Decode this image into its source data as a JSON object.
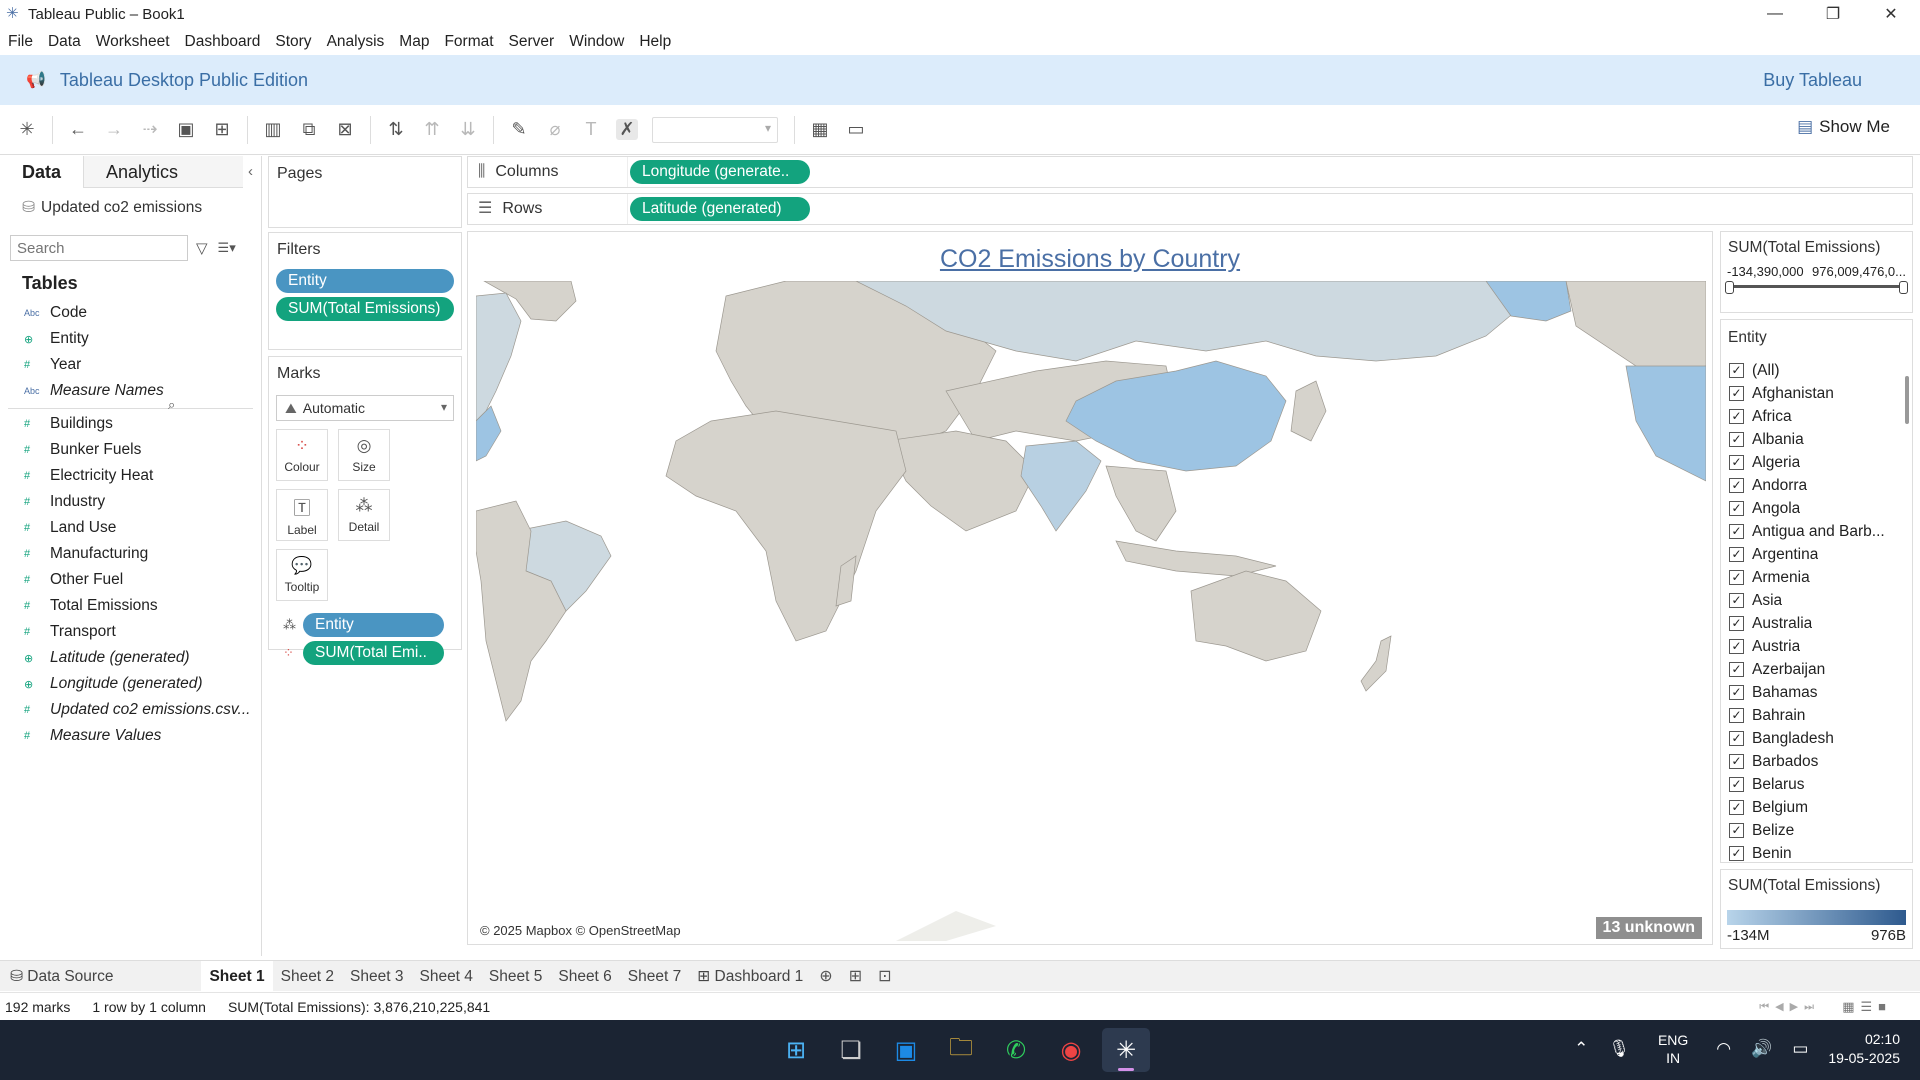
{
  "window": {
    "title": "Tableau Public – Book1"
  },
  "menu": [
    "File",
    "Data",
    "Worksheet",
    "Dashboard",
    "Story",
    "Analysis",
    "Map",
    "Format",
    "Server",
    "Window",
    "Help"
  ],
  "banner": {
    "edition": "Tableau Desktop Public Edition",
    "buy": "Buy Tableau"
  },
  "toolbar": {
    "show_me": "Show Me"
  },
  "data_pane": {
    "tab_data": "Data",
    "tab_analytics": "Analytics",
    "source": "Updated co2 emissions",
    "search_placeholder": "Search",
    "tables_heading": "Tables",
    "dimensions": [
      {
        "icon": "Abc",
        "name": "Code",
        "italic": false
      },
      {
        "icon": "⊕",
        "name": "Entity",
        "italic": false
      },
      {
        "icon": "#",
        "name": "Year",
        "italic": false
      },
      {
        "icon": "Abc",
        "name": "Measure Names",
        "italic": true
      }
    ],
    "measures": [
      {
        "icon": "#",
        "name": "Buildings",
        "italic": false
      },
      {
        "icon": "#",
        "name": "Bunker Fuels",
        "italic": false
      },
      {
        "icon": "#",
        "name": "Electricity Heat",
        "italic": false
      },
      {
        "icon": "#",
        "name": "Industry",
        "italic": false
      },
      {
        "icon": "#",
        "name": "Land Use",
        "italic": false
      },
      {
        "icon": "#",
        "name": "Manufacturing",
        "italic": false
      },
      {
        "icon": "#",
        "name": "Other Fuel",
        "italic": false
      },
      {
        "icon": "#",
        "name": "Total Emissions",
        "italic": false
      },
      {
        "icon": "#",
        "name": "Transport",
        "italic": false
      },
      {
        "icon": "⊕",
        "name": "Latitude (generated)",
        "italic": true
      },
      {
        "icon": "⊕",
        "name": "Longitude (generated)",
        "italic": true
      },
      {
        "icon": "#",
        "name": "Updated co2 emissions.csv...",
        "italic": true
      },
      {
        "icon": "#",
        "name": "Measure Values",
        "italic": true
      }
    ]
  },
  "pages": {
    "label": "Pages"
  },
  "filters": {
    "label": "Filters",
    "pills": [
      "Entity",
      "SUM(Total Emissions)"
    ]
  },
  "marks": {
    "label": "Marks",
    "type": "Automatic",
    "buttons": [
      "Colour",
      "Size",
      "Label",
      "Detail",
      "Tooltip"
    ],
    "pills": [
      "Entity",
      "SUM(Total Emi.."
    ]
  },
  "shelves": {
    "columns_label": "Columns",
    "columns_pill": "Longitude (generate..",
    "rows_label": "Rows",
    "rows_pill": "Latitude (generated)"
  },
  "viz": {
    "title": "CO2 Emissions by Country",
    "attribution": "© 2025 Mapbox © OpenStreetMap",
    "unknown_badge": "13 unknown"
  },
  "range_filter": {
    "title": "SUM(Total Emissions)",
    "min": "-134,390,000",
    "max": "976,009,476,0..."
  },
  "entity_filter": {
    "title": "Entity",
    "items": [
      "(All)",
      "Afghanistan",
      "Africa",
      "Albania",
      "Algeria",
      "Andorra",
      "Angola",
      "Antigua and Barb...",
      "Argentina",
      "Armenia",
      "Asia",
      "Australia",
      "Austria",
      "Azerbaijan",
      "Bahamas",
      "Bahrain",
      "Bangladesh",
      "Barbados",
      "Belarus",
      "Belgium",
      "Belize",
      "Benin"
    ]
  },
  "color_legend": {
    "title": "SUM(Total Emissions)",
    "min": "-134M",
    "max": "976B",
    "low_color": "#b8d4ea",
    "high_color": "#2e5a8e"
  },
  "sheet_tabs": {
    "data_source": "Data Source",
    "tabs": [
      "Sheet 1",
      "Sheet 2",
      "Sheet 3",
      "Sheet 4",
      "Sheet 5",
      "Sheet 6",
      "Sheet 7",
      "Dashboard 1"
    ],
    "active": "Sheet 1"
  },
  "status": {
    "marks": "192 marks",
    "dims": "1 row by 1 column",
    "sum": "SUM(Total Emissions): 3,876,210,225,841"
  },
  "taskbar": {
    "lang1": "ENG",
    "lang2": "IN",
    "time": "02:10",
    "date": "19-05-2025"
  },
  "colors": {
    "accent": "#4a6fa5",
    "pill_dimension": "#4a95c2",
    "pill_measure": "#13a37e",
    "banner_bg": "#dcecfb",
    "taskbar_bg": "#1b2433"
  }
}
